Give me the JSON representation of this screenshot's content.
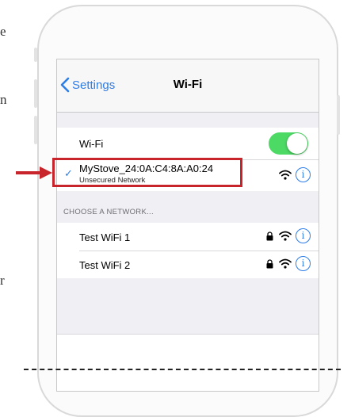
{
  "left_text": [
    "e",
    "n",
    "r"
  ],
  "nav": {
    "back_label": "Settings",
    "title": "Wi-Fi"
  },
  "wifi_toggle": {
    "label": "Wi-Fi",
    "on": true
  },
  "connected": {
    "name": "MyStove_24:0A:C4:8A:A0:24",
    "sub": "Unsecured Network",
    "check": "✓"
  },
  "section_header": "CHOOSE A NETWORK...",
  "networks": [
    {
      "name": "Test WiFi 1",
      "locked": true
    },
    {
      "name": "Test WiFi 2",
      "locked": true
    }
  ],
  "colors": {
    "accent": "#2d7de8",
    "toggle_on": "#4cd964",
    "highlight": "#c8242b"
  },
  "icons": [
    "chevron-left-icon",
    "checkmark-icon",
    "lock-icon",
    "wifi-icon",
    "info-icon",
    "arrow-right-icon"
  ]
}
